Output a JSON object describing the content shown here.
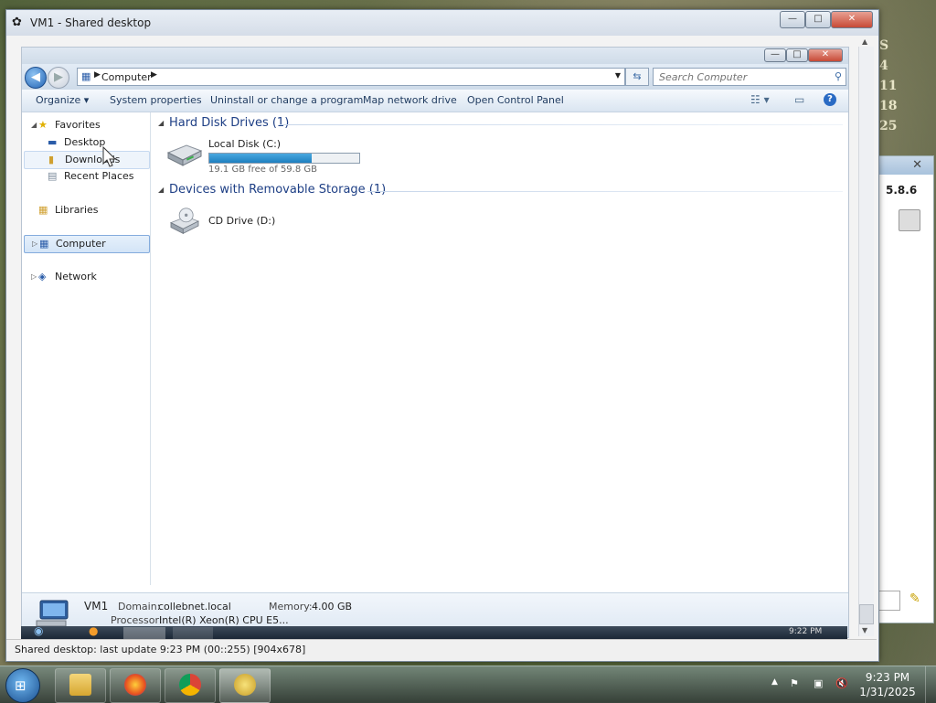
{
  "outer_window": {
    "title": "VM1 - Shared desktop",
    "status_text": "Shared desktop: last update 9:23 PM (00::255) [904x678]"
  },
  "explorer": {
    "address_crumb": "Computer",
    "search_placeholder": "Search Computer",
    "commands": {
      "organize": "Organize",
      "system_properties": "System properties",
      "uninstall": "Uninstall or change a program",
      "map_drive": "Map network drive",
      "control_panel": "Open Control Panel"
    },
    "nav": {
      "favorites": "Favorites",
      "desktop": "Desktop",
      "downloads": "Downloads",
      "recent": "Recent Places",
      "libraries": "Libraries",
      "computer": "Computer",
      "network": "Network"
    },
    "groups": {
      "hdd_header": "Hard Disk Drives (1)",
      "removable_header": "Devices with Removable Storage (1)"
    },
    "drives": {
      "c_name": "Local Disk (C:)",
      "c_space": "19.1 GB free of 59.8 GB",
      "c_used_fraction": 0.68,
      "d_name": "CD Drive (D:)"
    },
    "details": {
      "computer_name": "VM1",
      "domain_label": "Domain:",
      "domain_value": "collebnet.local",
      "memory_label": "Memory:",
      "memory_value": "4.00 GB",
      "processor_label": "Processor:",
      "processor_value": "Intel(R) Xeon(R) CPU E5..."
    },
    "remote_clock": "9:22 PM"
  },
  "background_window": {
    "version": "5.8.6"
  },
  "desktop_text": [
    "S",
    "4",
    "11",
    "18",
    "25"
  ],
  "taskbar": {
    "time": "9:23 PM",
    "date": "1/31/2025"
  },
  "colors": {
    "accent": "#2a6bc4",
    "drive_bar": "#1e7fbf",
    "close_red": "#c74a36"
  }
}
